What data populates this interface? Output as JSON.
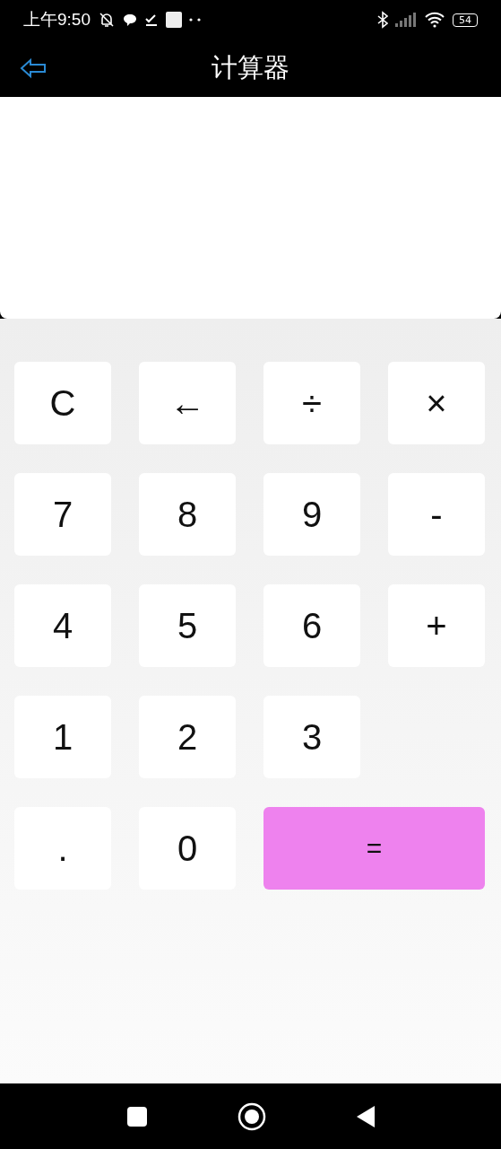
{
  "status_bar": {
    "time": "上午9:50",
    "battery": "54"
  },
  "header": {
    "title": "计算器"
  },
  "keys": [
    {
      "label": "C",
      "kind": "key"
    },
    {
      "label": "←",
      "kind": "key"
    },
    {
      "label": "÷",
      "kind": "key"
    },
    {
      "label": "×",
      "kind": "key"
    },
    {
      "label": "7",
      "kind": "key"
    },
    {
      "label": "8",
      "kind": "key"
    },
    {
      "label": "9",
      "kind": "key"
    },
    {
      "label": "-",
      "kind": "key"
    },
    {
      "label": "4",
      "kind": "key"
    },
    {
      "label": "5",
      "kind": "key"
    },
    {
      "label": "6",
      "kind": "key"
    },
    {
      "label": "+",
      "kind": "key"
    },
    {
      "label": "1",
      "kind": "key"
    },
    {
      "label": "2",
      "kind": "key"
    },
    {
      "label": "3",
      "kind": "key"
    },
    {
      "kind": "gap"
    },
    {
      "label": ".",
      "kind": "key"
    },
    {
      "label": "0",
      "kind": "key"
    },
    {
      "label": "=",
      "kind": "equals"
    }
  ]
}
